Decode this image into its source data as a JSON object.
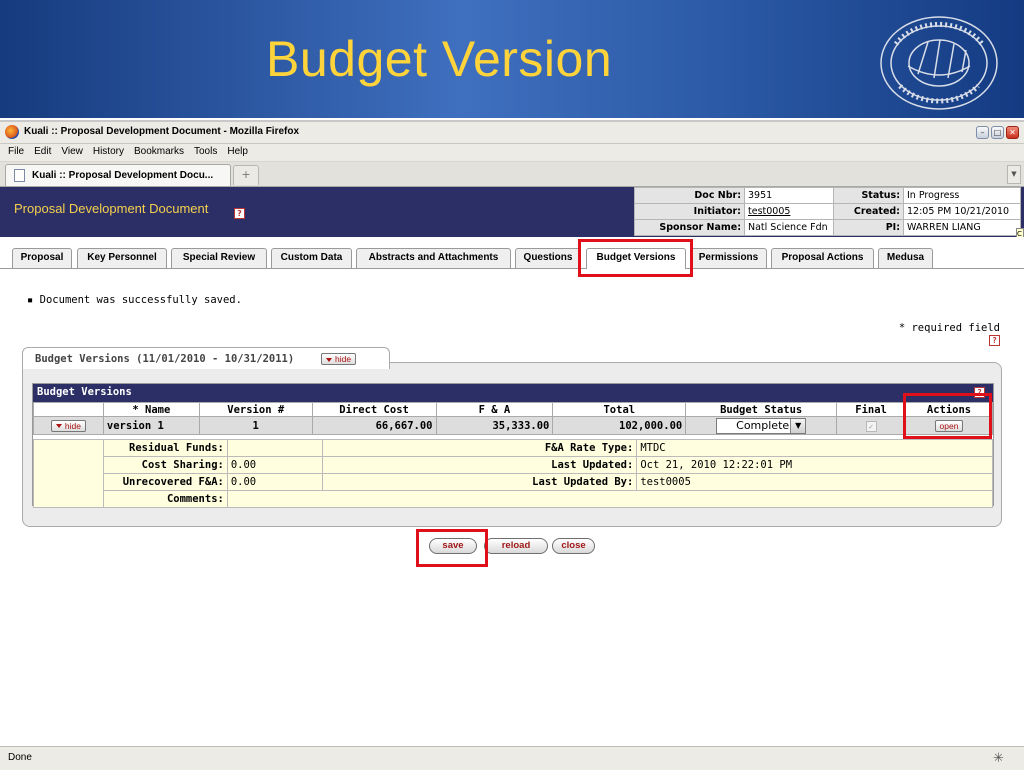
{
  "slide": {
    "title": "Budget Version"
  },
  "browser": {
    "window_title": "Kuali :: Proposal Development Document - Mozilla Firefox",
    "menu": [
      "File",
      "Edit",
      "View",
      "History",
      "Bookmarks",
      "Tools",
      "Help"
    ],
    "tab_label": "Kuali :: Proposal Development Docu...",
    "new_tab": "+",
    "status_text": "Done"
  },
  "header": {
    "title": "Proposal Development Document",
    "help": "?",
    "doc_nbr_label": "Doc Nbr:",
    "doc_nbr": "3951",
    "status_label": "Status:",
    "status": "In Progress",
    "initiator_label": "Initiator:",
    "initiator": "test0005",
    "created_label": "Created:",
    "created": "12:05 PM 10/21/2010",
    "sponsor_label": "Sponsor Name:",
    "sponsor": "Natl Science Fdn",
    "pi_label": "PI:",
    "pi": "WARREN LIANG"
  },
  "tabs": [
    "Proposal",
    "Key Personnel",
    "Special Review",
    "Custom Data",
    "Abstracts and Attachments",
    "Questions",
    "Budget Versions",
    "Permissions",
    "Proposal Actions",
    "Medusa"
  ],
  "active_tab": "Budget Versions",
  "message": "Document was successfully saved.",
  "required_note": "* required field",
  "panel": {
    "tab_title": "Budget Versions (11/01/2010 - 10/31/2011)",
    "hide_label": "hide",
    "inner_title": "Budget Versions",
    "columns": [
      "* Name",
      "Version #",
      "Direct Cost",
      "F & A",
      "Total",
      "Budget Status",
      "Final",
      "Actions"
    ],
    "row": {
      "hide": "hide",
      "name": "version 1",
      "version": "1",
      "direct_cost": "66,667.00",
      "fa": "35,333.00",
      "total": "102,000.00",
      "budget_status": "Complete",
      "final_checked": true,
      "action": "open"
    },
    "details": {
      "residual_funds_label": "Residual Funds:",
      "residual_funds": "",
      "cost_sharing_label": "Cost Sharing:",
      "cost_sharing": "0.00",
      "unrecovered_label": "Unrecovered F&A:",
      "unrecovered": "0.00",
      "comments_label": "Comments:",
      "comments": "",
      "rate_type_label": "F&A Rate Type:",
      "rate_type": "MTDC",
      "last_updated_label": "Last Updated:",
      "last_updated": "Oct 21, 2010 12:22:01 PM",
      "last_updated_by_label": "Last Updated By:",
      "last_updated_by": "test0005"
    }
  },
  "buttons": {
    "save": "save",
    "reload": "reload",
    "close": "close"
  },
  "colors": {
    "slide_title": "#ffd43b",
    "kuali_navy": "#2b2f66",
    "highlight_red": "#e0101a"
  }
}
